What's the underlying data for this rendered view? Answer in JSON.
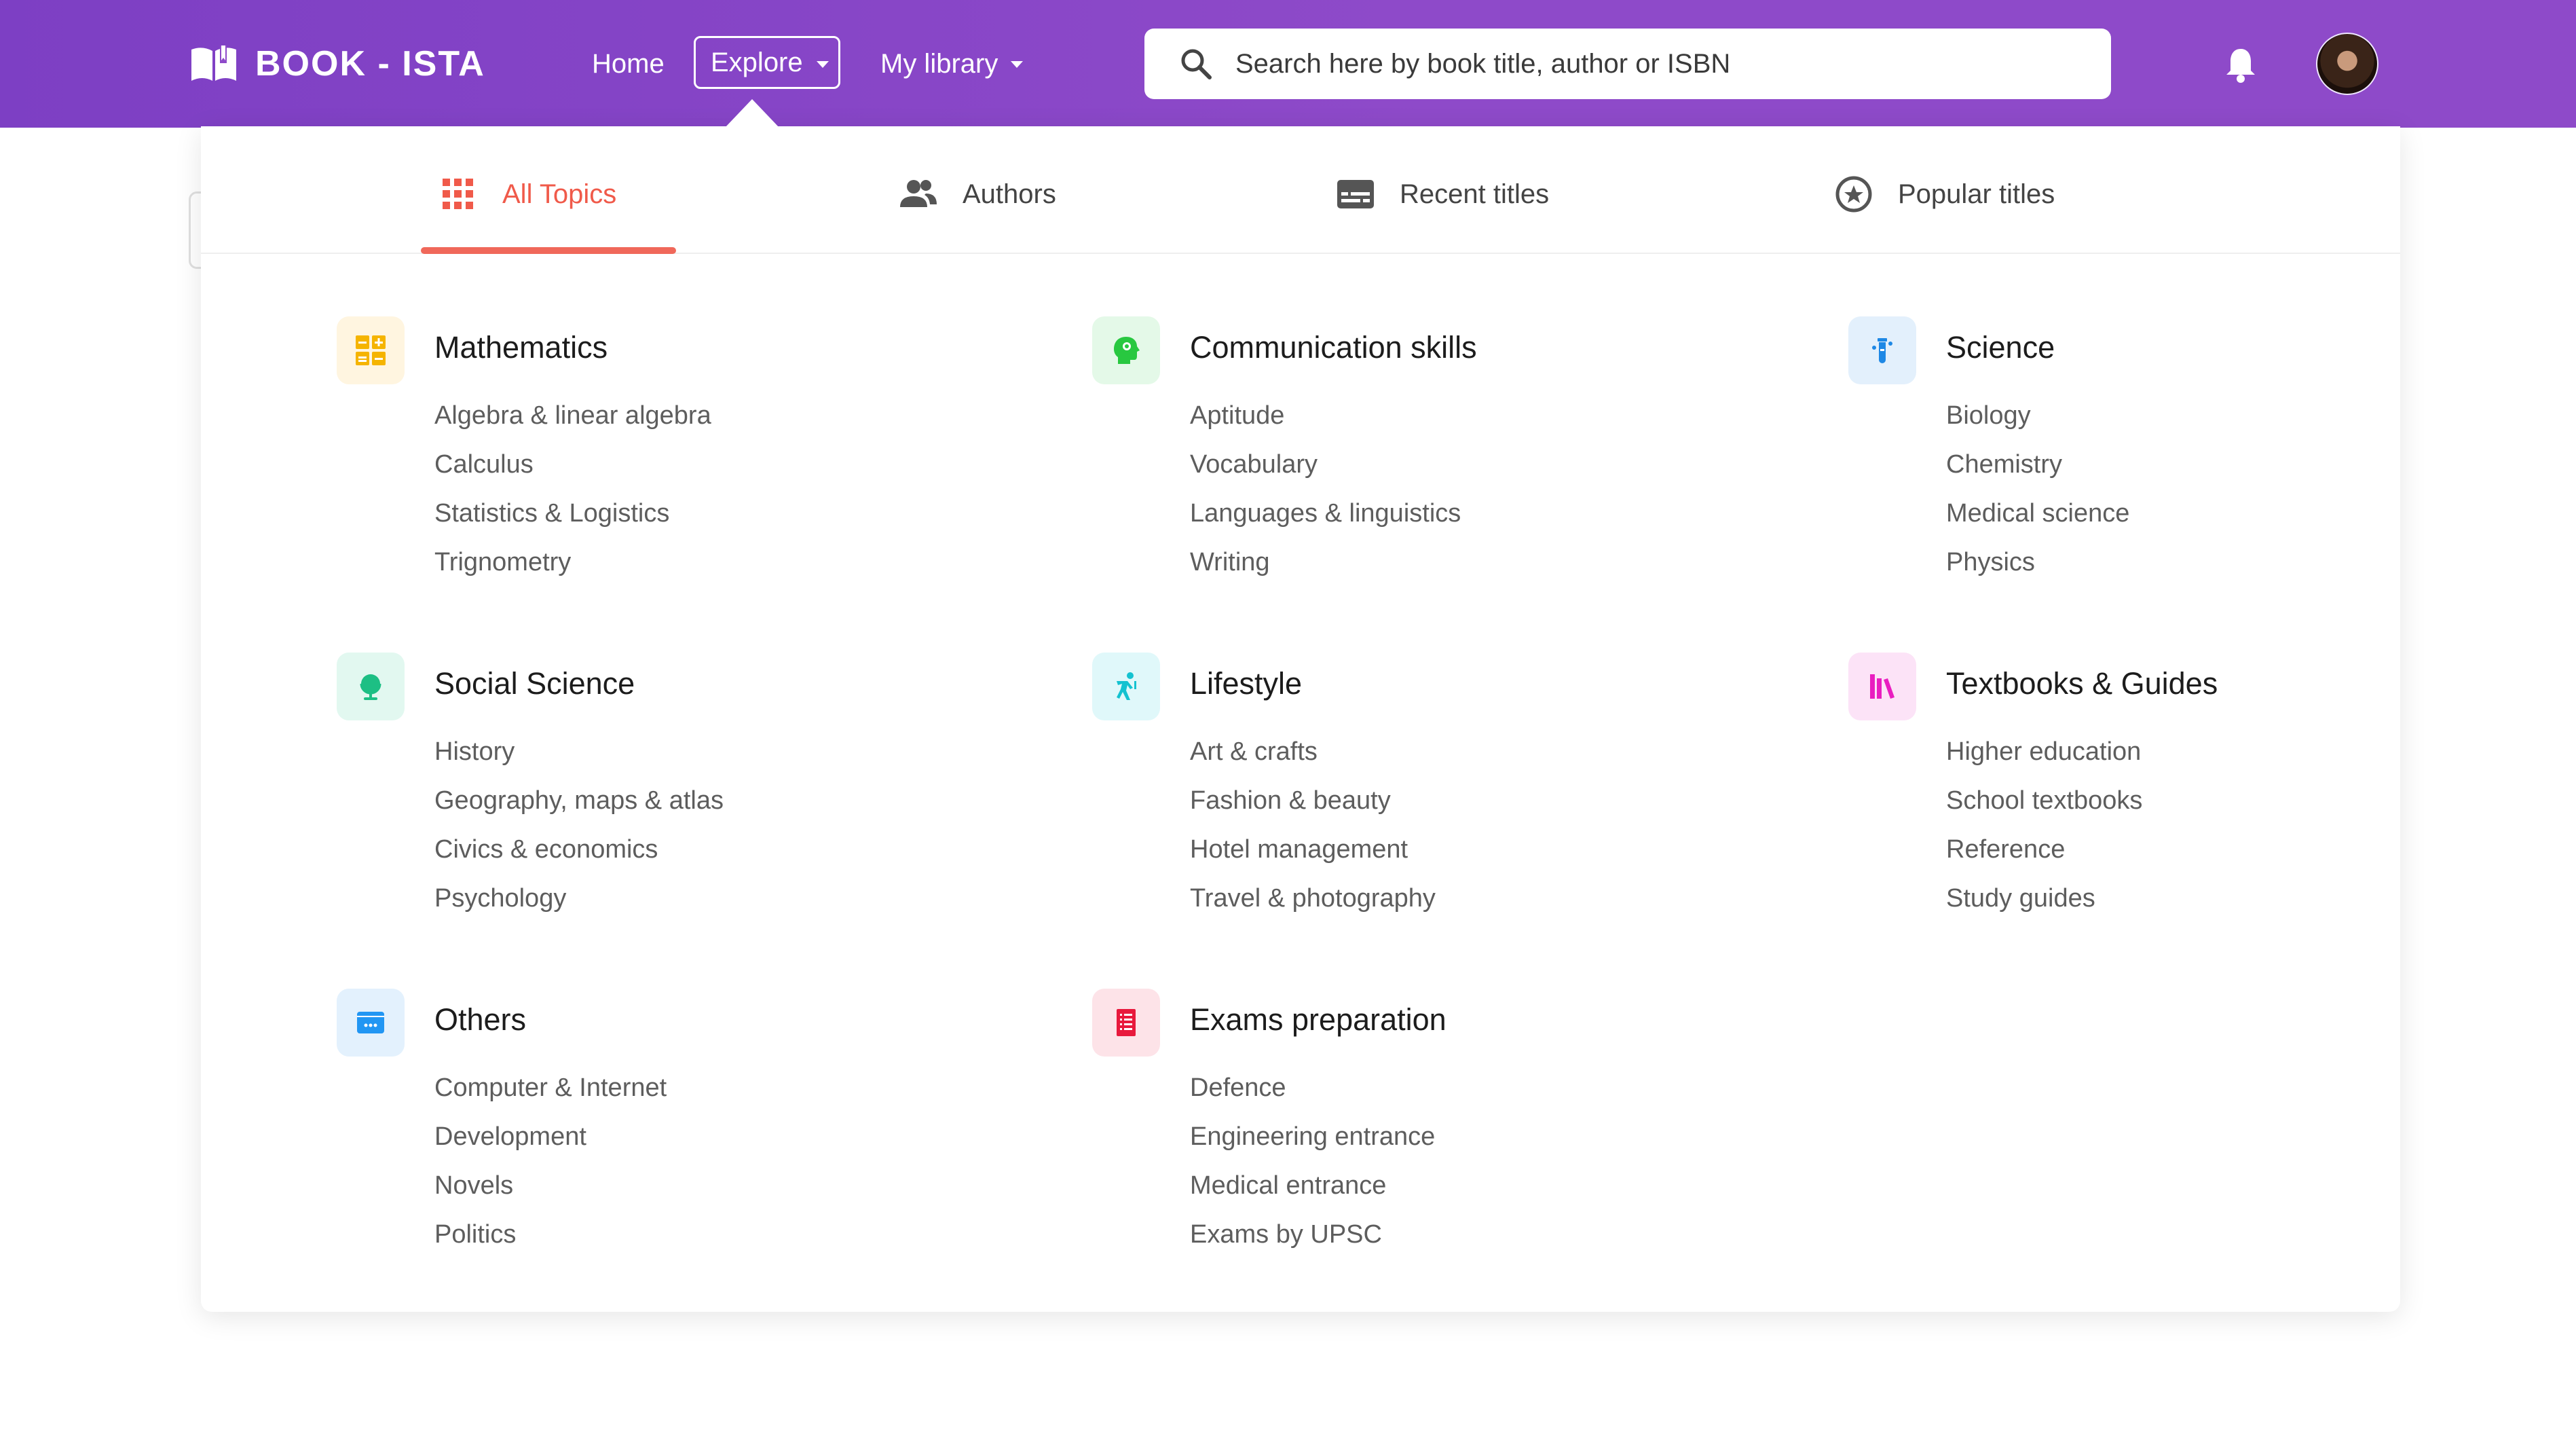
{
  "header": {
    "logo_text": "BOOK - ISTA",
    "nav": {
      "home": "Home",
      "explore": "Explore",
      "library": "My library"
    },
    "search_placeholder": "Search here by book title, author or ISBN"
  },
  "tabs": [
    {
      "label": "All Topics",
      "icon": "grid-icon",
      "active": true
    },
    {
      "label": "Authors",
      "icon": "people-icon",
      "active": false
    },
    {
      "label": "Recent titles",
      "icon": "subtitles-icon",
      "active": false
    },
    {
      "label": "Popular titles",
      "icon": "star-circle-icon",
      "active": false
    }
  ],
  "colors": {
    "header": "#8e4ac9",
    "active_tab": "#f05a4a",
    "mathematics": "#f5b400",
    "communication": "#28c840",
    "science": "#1e88e5",
    "social_science": "#1dbf84",
    "lifestyle": "#14c2d0",
    "textbooks": "#e91ec0",
    "others": "#2196f3",
    "exams": "#e8193c"
  },
  "categories": [
    {
      "title": "Mathematics",
      "icon": "calculator-icon",
      "items": [
        "Algebra & linear algebra",
        "Calculus",
        "Statistics & Logistics",
        "Trignometry"
      ]
    },
    {
      "title": "Communication skills",
      "icon": "head-speech-icon",
      "items": [
        "Aptitude",
        "Vocabulary",
        "Languages & linguistics",
        "Writing"
      ]
    },
    {
      "title": "Science",
      "icon": "test-tube-icon",
      "items": [
        "Biology",
        "Chemistry",
        "Medical science",
        "Physics"
      ]
    },
    {
      "title": "Social Science",
      "icon": "globe-icon",
      "items": [
        "History",
        "Geography, maps & atlas",
        "Civics & economics",
        "Psychology"
      ]
    },
    {
      "title": "Lifestyle",
      "icon": "dancer-icon",
      "items": [
        "Art & crafts",
        "Fashion & beauty",
        "Hotel management",
        "Travel & photography"
      ]
    },
    {
      "title": "Textbooks & Guides",
      "icon": "books-icon",
      "items": [
        "Higher education",
        "School textbooks",
        "Reference",
        "Study guides"
      ]
    },
    {
      "title": "Others",
      "icon": "window-dots-icon",
      "items": [
        "Computer & Internet",
        "Development",
        "Novels",
        "Politics"
      ]
    },
    {
      "title": "Exams preparation",
      "icon": "notebook-icon",
      "items": [
        "Defence",
        "Engineering entrance",
        "Medical entrance",
        "Exams by UPSC"
      ]
    }
  ]
}
